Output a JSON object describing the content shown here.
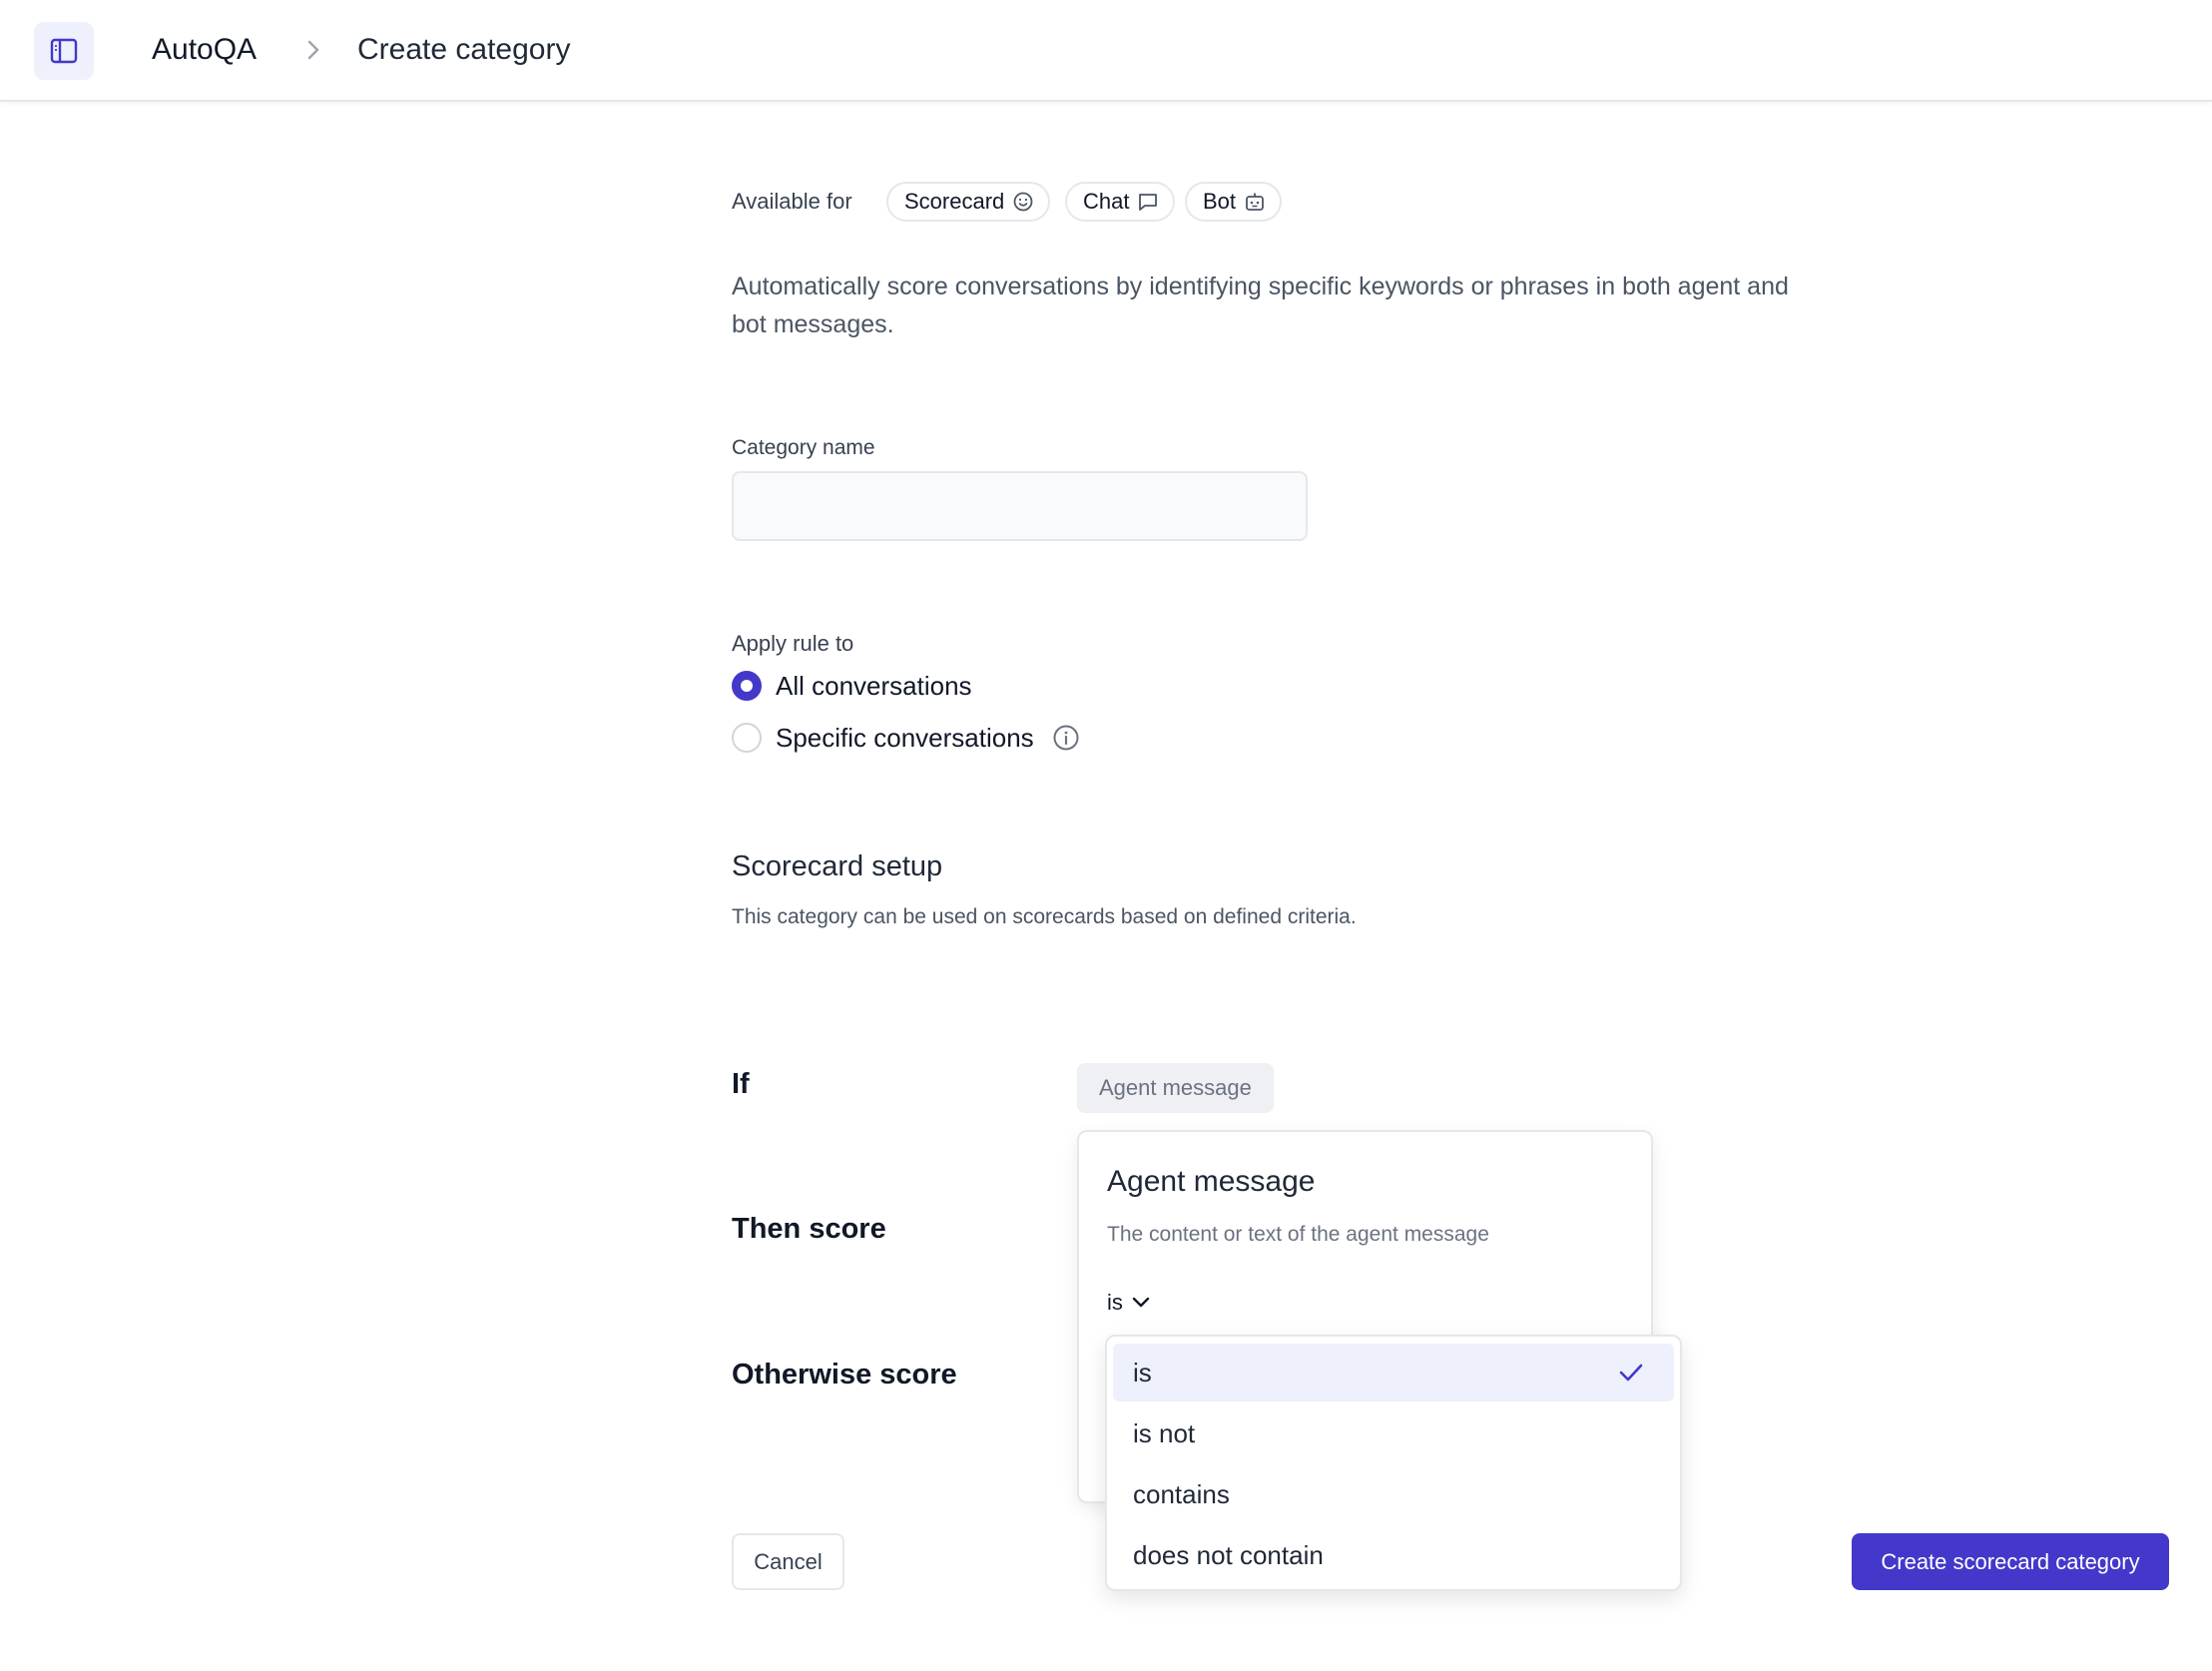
{
  "header": {
    "breadcrumb_root": "AutoQA",
    "breadcrumb_current": "Create category"
  },
  "available_for": {
    "label": "Available for",
    "chips": [
      {
        "label": "Scorecard",
        "icon": "smiley-icon"
      },
      {
        "label": "Chat",
        "icon": "chat-bubble-icon"
      },
      {
        "label": "Bot",
        "icon": "robot-icon"
      }
    ]
  },
  "description": "Automatically score conversations by identifying specific keywords or phrases in both agent and bot messages.",
  "category_name": {
    "label": "Category name",
    "value": "",
    "placeholder": ""
  },
  "apply_rule": {
    "label": "Apply rule to",
    "options": [
      {
        "label": "All conversations",
        "checked": true
      },
      {
        "label": "Specific conversations",
        "checked": false,
        "has_info": true
      }
    ]
  },
  "scorecard_setup": {
    "title": "Scorecard setup",
    "subtitle": "This category can be used on scorecards based on defined criteria."
  },
  "rules": {
    "if_label": "If",
    "then_label": "Then score",
    "otherwise_label": "Otherwise score",
    "attribute_pill": "Agent message"
  },
  "popover": {
    "title": "Agent message",
    "subtitle": "The content or text of the agent message",
    "operator_value": "is"
  },
  "operator_dropdown": {
    "options": [
      "is",
      "is not",
      "contains",
      "does not contain"
    ],
    "selected": "is"
  },
  "footer": {
    "cancel_label": "Cancel",
    "create_label": "Create scorecard category"
  },
  "colors": {
    "accent": "#4338ca",
    "selected_bg": "#eef0fb"
  }
}
